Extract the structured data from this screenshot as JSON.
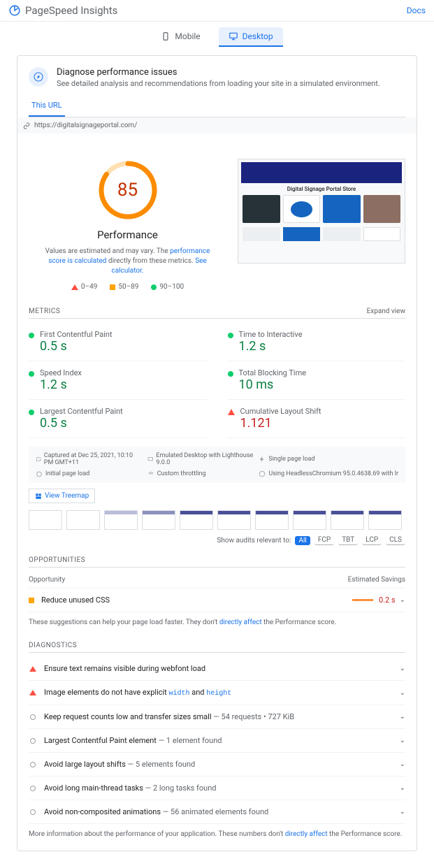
{
  "header": {
    "title": "PageSpeed Insights",
    "docs": "Docs"
  },
  "tabs": {
    "mobile": "Mobile",
    "desktop": "Desktop"
  },
  "diagnose": {
    "title": "Diagnose performance issues",
    "sub": "See detailed analysis and recommendations from loading your site in a simulated environment."
  },
  "url_tab": "This URL",
  "url": "https://digitalsignageportal.com/",
  "performance": {
    "score": "85",
    "label": "Performance",
    "desc_1": "Values are estimated and may vary. The ",
    "link_1": "performance score is calculated",
    "desc_2": " directly from these metrics. ",
    "link_2": "See calculator.",
    "legend_bad": "0–49",
    "legend_mid": "50–89",
    "legend_good": "90–100"
  },
  "screenshot_title": "Digital Signage Portal Store",
  "metrics_header": "METRICS",
  "expand": "Expand view",
  "metrics": {
    "fcp": {
      "name": "First Contentful Paint",
      "value": "0.5 s"
    },
    "tti": {
      "name": "Time to Interactive",
      "value": "1.2 s"
    },
    "si": {
      "name": "Speed Index",
      "value": "1.2 s"
    },
    "tbt": {
      "name": "Total Blocking Time",
      "value": "10 ms"
    },
    "lcp": {
      "name": "Largest Contentful Paint",
      "value": "0.5 s"
    },
    "cls": {
      "name": "Cumulative Layout Shift",
      "value": "1.121"
    }
  },
  "env": {
    "captured": "Captured at Dec 25, 2021, 10:10 PM GMT+11",
    "emulated": "Emulated Desktop with Lighthouse 9.0.0",
    "single": "Single page load",
    "initial": "Initial page load",
    "throttling": "Custom throttling",
    "chromium": "Using HeadlessChromium 95.0.4638.69 with lr"
  },
  "treemap": "View Treemap",
  "filter": {
    "label": "Show audits relevant to:",
    "all": "All",
    "fcp": "FCP",
    "tbt": "TBT",
    "lcp": "LCP",
    "cls": "CLS"
  },
  "opportunities": {
    "header": "OPPORTUNITIES",
    "col_opp": "Opportunity",
    "col_save": "Estimated Savings",
    "item_1": "Reduce unused CSS",
    "item_1_val": "0.2 s",
    "note_1": "These suggestions can help your page load faster. They don't ",
    "note_link": "directly affect",
    "note_2": " the Performance score."
  },
  "diagnostics": {
    "header": "DIAGNOSTICS",
    "d1": "Ensure text remains visible during webfont load",
    "d2_a": "Image elements do not have explicit ",
    "d2_w": "width",
    "d2_and": " and ",
    "d2_h": "height",
    "d3": "Keep request counts low and transfer sizes small",
    "d3_sub": " — 54 requests • 727 KiB",
    "d4": "Largest Contentful Paint element",
    "d4_sub": " — 1 element found",
    "d5": "Avoid large layout shifts",
    "d5_sub": " — 5 elements found",
    "d6": "Avoid long main-thread tasks",
    "d6_sub": " — 2 long tasks found",
    "d7": "Avoid non-composited animations",
    "d7_sub": " — 56 animated elements found",
    "note_1": "More information about the performance of your application. These numbers don't ",
    "note_link": "directly affect",
    "note_2": " the Performance score."
  }
}
